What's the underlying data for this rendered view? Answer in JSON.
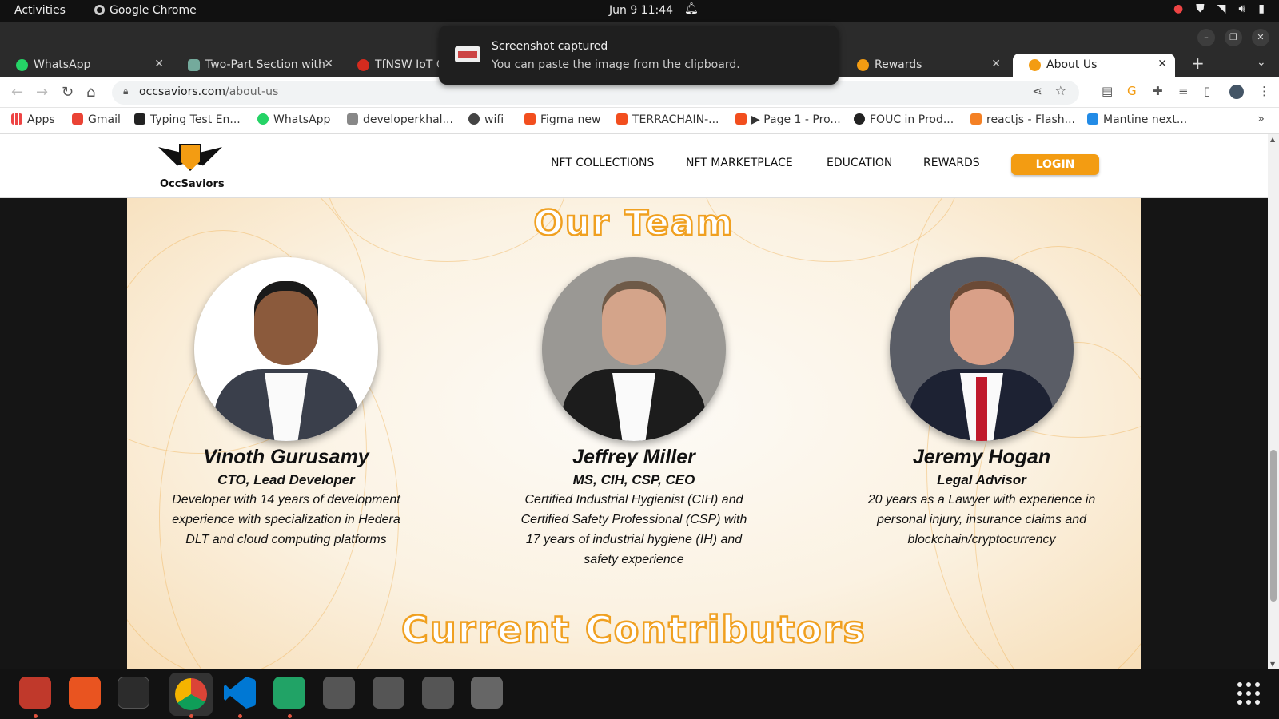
{
  "system": {
    "activities": "Activities",
    "app_name": "Google Chrome",
    "clock": "Jun 9  11:44"
  },
  "toast": {
    "title": "Screenshot captured",
    "message": "You can paste the image from the clipboard."
  },
  "tabs": [
    {
      "label": "WhatsApp",
      "icon_color": "#25d366"
    },
    {
      "label": "Two-Part Section with",
      "icon_color": "#74aa9c"
    },
    {
      "label": "TfNSW IoT C",
      "icon_color": "#d52b1e"
    },
    {
      "label": "Rewards",
      "icon_color": "#f39c12"
    },
    {
      "label": "About Us",
      "icon_color": "#f39c12"
    }
  ],
  "address": {
    "domain": "occsaviors.com",
    "path": "/about-us"
  },
  "bookmarks": [
    {
      "label": "Apps",
      "color": "#e44"
    },
    {
      "label": "Gmail",
      "color": "#ea4335"
    },
    {
      "label": "Typing Test En...",
      "color": "#222"
    },
    {
      "label": "WhatsApp",
      "color": "#25d366"
    },
    {
      "label": "developerkhal...",
      "color": "#888"
    },
    {
      "label": "wifi",
      "color": "#444"
    },
    {
      "label": "Figma new",
      "color": "#f24e1e"
    },
    {
      "label": "TERRACHAIN-...",
      "color": "#f24e1e"
    },
    {
      "label": "▶ Page 1 - Pro...",
      "color": "#f24e1e"
    },
    {
      "label": "FOUC in Prod...",
      "color": "#222"
    },
    {
      "label": "reactjs - Flash...",
      "color": "#f48024"
    },
    {
      "label": "Mantine next...",
      "color": "#228be6"
    }
  ],
  "site": {
    "logo_text": "OccSaviors",
    "nav": [
      "NFT COLLECTIONS",
      "NFT MARKETPLACE",
      "EDUCATION",
      "REWARDS"
    ],
    "login": "LOGIN",
    "team_heading": "Our Team",
    "contributors_heading": "Current Contributors",
    "team": [
      {
        "name": "Vinoth Gurusamy",
        "role": "CTO, Lead Developer",
        "description": "Developer with 14 years of development experience with specialization in Hedera DLT and cloud computing platforms",
        "photo_bg": "#ffffff",
        "skin": "#8b5a3c",
        "suit": "#3a3f4b"
      },
      {
        "name": "Jeffrey Miller",
        "role": "MS, CIH, CSP, CEO",
        "description": "Certified Industrial Hygienist (CIH) and Certified Safety Professional (CSP) with 17 years of industrial hygiene (IH) and safety experience",
        "photo_bg": "#9a9894",
        "skin": "#d4a48a",
        "suit": "#1c1c1c"
      },
      {
        "name": "Jeremy Hogan",
        "role": "Legal Advisor",
        "description": "20 years as a Lawyer with experience in personal injury, insurance claims and blockchain/cryptocurrency",
        "photo_bg": "#5a5d66",
        "skin": "#d9a088",
        "suit": "#1d2233"
      }
    ]
  },
  "accent": "#f39c12"
}
